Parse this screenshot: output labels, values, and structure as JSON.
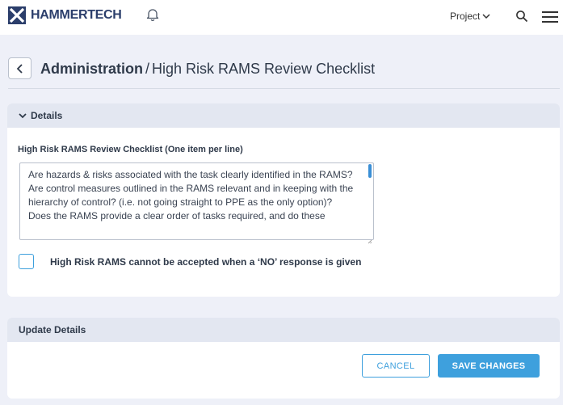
{
  "header": {
    "brand": "HAMMERTECH",
    "project_label": "Project"
  },
  "page": {
    "breadcrumb_root": "Administration",
    "separator": "/",
    "title": "High Risk RAMS Review Checklist"
  },
  "details": {
    "section_title": "Details",
    "field_label": "High Risk RAMS Review Checklist (One item per line)",
    "checklist_text": "Are hazards & risks associated with the task clearly identified in the RAMS?\nAre control measures outlined in the RAMS relevant and in keeping with the hierarchy of control? (i.e. not going straight to PPE as the only option)?\nDoes the RAMS provide a clear order of tasks required, and do these",
    "checkbox_label": "High Risk RAMS cannot be accepted when a ‘NO’ response is given",
    "checkbox_checked": false
  },
  "update": {
    "section_title": "Update Details",
    "cancel_label": "CANCEL",
    "save_label": "SAVE CHANGES"
  },
  "colors": {
    "brand": "#2b3e6b",
    "accent": "#3ea0dd",
    "background": "#eef0f8",
    "section_header": "#e3e7f1"
  }
}
